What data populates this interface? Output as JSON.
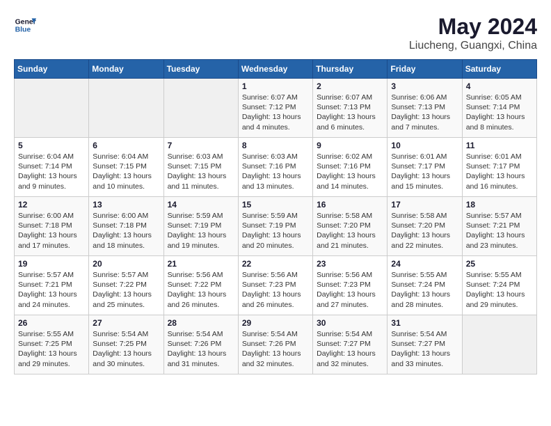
{
  "header": {
    "logo_line1": "General",
    "logo_line2": "Blue",
    "title": "May 2024",
    "subtitle": "Liucheng, Guangxi, China"
  },
  "weekdays": [
    "Sunday",
    "Monday",
    "Tuesday",
    "Wednesday",
    "Thursday",
    "Friday",
    "Saturday"
  ],
  "weeks": [
    [
      {
        "day": "",
        "info": ""
      },
      {
        "day": "",
        "info": ""
      },
      {
        "day": "",
        "info": ""
      },
      {
        "day": "1",
        "info": "Sunrise: 6:07 AM\nSunset: 7:12 PM\nDaylight: 13 hours\nand 4 minutes."
      },
      {
        "day": "2",
        "info": "Sunrise: 6:07 AM\nSunset: 7:13 PM\nDaylight: 13 hours\nand 6 minutes."
      },
      {
        "day": "3",
        "info": "Sunrise: 6:06 AM\nSunset: 7:13 PM\nDaylight: 13 hours\nand 7 minutes."
      },
      {
        "day": "4",
        "info": "Sunrise: 6:05 AM\nSunset: 7:14 PM\nDaylight: 13 hours\nand 8 minutes."
      }
    ],
    [
      {
        "day": "5",
        "info": "Sunrise: 6:04 AM\nSunset: 7:14 PM\nDaylight: 13 hours\nand 9 minutes."
      },
      {
        "day": "6",
        "info": "Sunrise: 6:04 AM\nSunset: 7:15 PM\nDaylight: 13 hours\nand 10 minutes."
      },
      {
        "day": "7",
        "info": "Sunrise: 6:03 AM\nSunset: 7:15 PM\nDaylight: 13 hours\nand 11 minutes."
      },
      {
        "day": "8",
        "info": "Sunrise: 6:03 AM\nSunset: 7:16 PM\nDaylight: 13 hours\nand 13 minutes."
      },
      {
        "day": "9",
        "info": "Sunrise: 6:02 AM\nSunset: 7:16 PM\nDaylight: 13 hours\nand 14 minutes."
      },
      {
        "day": "10",
        "info": "Sunrise: 6:01 AM\nSunset: 7:17 PM\nDaylight: 13 hours\nand 15 minutes."
      },
      {
        "day": "11",
        "info": "Sunrise: 6:01 AM\nSunset: 7:17 PM\nDaylight: 13 hours\nand 16 minutes."
      }
    ],
    [
      {
        "day": "12",
        "info": "Sunrise: 6:00 AM\nSunset: 7:18 PM\nDaylight: 13 hours\nand 17 minutes."
      },
      {
        "day": "13",
        "info": "Sunrise: 6:00 AM\nSunset: 7:18 PM\nDaylight: 13 hours\nand 18 minutes."
      },
      {
        "day": "14",
        "info": "Sunrise: 5:59 AM\nSunset: 7:19 PM\nDaylight: 13 hours\nand 19 minutes."
      },
      {
        "day": "15",
        "info": "Sunrise: 5:59 AM\nSunset: 7:19 PM\nDaylight: 13 hours\nand 20 minutes."
      },
      {
        "day": "16",
        "info": "Sunrise: 5:58 AM\nSunset: 7:20 PM\nDaylight: 13 hours\nand 21 minutes."
      },
      {
        "day": "17",
        "info": "Sunrise: 5:58 AM\nSunset: 7:20 PM\nDaylight: 13 hours\nand 22 minutes."
      },
      {
        "day": "18",
        "info": "Sunrise: 5:57 AM\nSunset: 7:21 PM\nDaylight: 13 hours\nand 23 minutes."
      }
    ],
    [
      {
        "day": "19",
        "info": "Sunrise: 5:57 AM\nSunset: 7:21 PM\nDaylight: 13 hours\nand 24 minutes."
      },
      {
        "day": "20",
        "info": "Sunrise: 5:57 AM\nSunset: 7:22 PM\nDaylight: 13 hours\nand 25 minutes."
      },
      {
        "day": "21",
        "info": "Sunrise: 5:56 AM\nSunset: 7:22 PM\nDaylight: 13 hours\nand 26 minutes."
      },
      {
        "day": "22",
        "info": "Sunrise: 5:56 AM\nSunset: 7:23 PM\nDaylight: 13 hours\nand 26 minutes."
      },
      {
        "day": "23",
        "info": "Sunrise: 5:56 AM\nSunset: 7:23 PM\nDaylight: 13 hours\nand 27 minutes."
      },
      {
        "day": "24",
        "info": "Sunrise: 5:55 AM\nSunset: 7:24 PM\nDaylight: 13 hours\nand 28 minutes."
      },
      {
        "day": "25",
        "info": "Sunrise: 5:55 AM\nSunset: 7:24 PM\nDaylight: 13 hours\nand 29 minutes."
      }
    ],
    [
      {
        "day": "26",
        "info": "Sunrise: 5:55 AM\nSunset: 7:25 PM\nDaylight: 13 hours\nand 29 minutes."
      },
      {
        "day": "27",
        "info": "Sunrise: 5:54 AM\nSunset: 7:25 PM\nDaylight: 13 hours\nand 30 minutes."
      },
      {
        "day": "28",
        "info": "Sunrise: 5:54 AM\nSunset: 7:26 PM\nDaylight: 13 hours\nand 31 minutes."
      },
      {
        "day": "29",
        "info": "Sunrise: 5:54 AM\nSunset: 7:26 PM\nDaylight: 13 hours\nand 32 minutes."
      },
      {
        "day": "30",
        "info": "Sunrise: 5:54 AM\nSunset: 7:27 PM\nDaylight: 13 hours\nand 32 minutes."
      },
      {
        "day": "31",
        "info": "Sunrise: 5:54 AM\nSunset: 7:27 PM\nDaylight: 13 hours\nand 33 minutes."
      },
      {
        "day": "",
        "info": ""
      }
    ]
  ]
}
